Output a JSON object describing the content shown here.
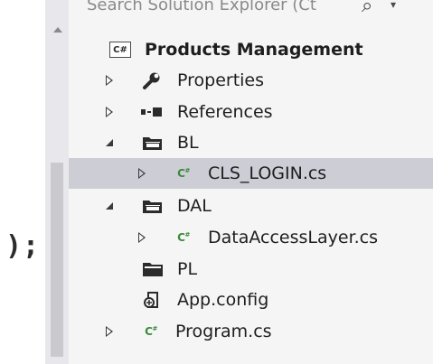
{
  "editor": {
    "code_fragment": ");"
  },
  "search": {
    "placeholder": "Search Solution Explorer (Ct"
  },
  "tree": {
    "solution": {
      "label": "Products Management",
      "icon": "csharp-project-icon"
    },
    "items": [
      {
        "label": "Properties",
        "icon": "wrench-icon",
        "expander": "collapsed"
      },
      {
        "label": "References",
        "icon": "references-icon",
        "expander": "collapsed"
      },
      {
        "label": "BL",
        "icon": "folder-open-icon",
        "expander": "expanded"
      },
      {
        "label": "CLS_LOGIN.cs",
        "icon": "csharp-file-icon",
        "expander": "collapsed",
        "selected": true
      },
      {
        "label": "DAL",
        "icon": "folder-open-icon",
        "expander": "expanded"
      },
      {
        "label": "DataAccessLayer.cs",
        "icon": "csharp-file-icon",
        "expander": "collapsed"
      },
      {
        "label": "PL",
        "icon": "folder-icon",
        "expander": "none"
      },
      {
        "label": "App.config",
        "icon": "config-file-icon",
        "expander": "none"
      },
      {
        "label": "Program.cs",
        "icon": "csharp-file-icon",
        "expander": "collapsed"
      }
    ]
  },
  "colors": {
    "selection": "#cdcdd6",
    "csharp_green": "#3a8a3a",
    "text": "#1e1e1e"
  }
}
